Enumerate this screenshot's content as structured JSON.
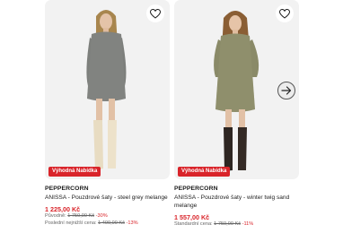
{
  "products": [
    {
      "brand": "PEPPERCORN",
      "name": "ANISSA - Pouzdrové šaty - steel grey melange",
      "badge": "Výhodná Nabídka",
      "price": "1 225,00 Kč",
      "orig_label": "Původně:",
      "orig_price": "1 750,00 Kč",
      "orig_discount": "-30%",
      "low_label": "Poslední nejnižší cena:",
      "low_price": "1 400,00 Kč",
      "low_discount": "-13%",
      "dress_color": "#7d7f7c"
    },
    {
      "brand": "PEPPERCORN",
      "name": "ANISSA - Pouzdrové šaty - winter twig sand melange",
      "badge": "Výhodná Nabídka",
      "price": "1 557,00 Kč",
      "std_label": "Standardní cena:",
      "std_price": "1 750,00 Kč",
      "std_discount": "-11%",
      "dress_color": "#8a8a68"
    }
  ],
  "icons": {
    "wishlist": "heart-icon",
    "next": "arrow-right-icon"
  },
  "colors": {
    "sale": "#d9242a",
    "image_bg": "#f2f2f2"
  }
}
